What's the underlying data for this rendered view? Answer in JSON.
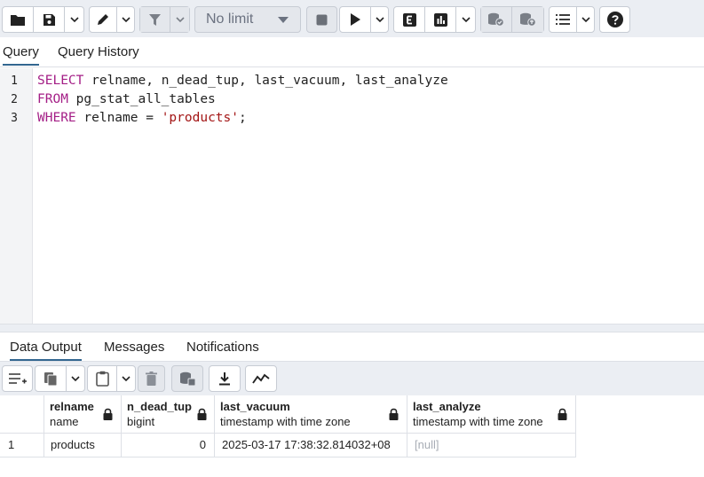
{
  "toolbar": {
    "limit_select": {
      "value": "No limit"
    },
    "icons": [
      "folder-icon",
      "save-icon",
      "pencil-icon",
      "filter-icon",
      "stop-icon",
      "play-icon",
      "explain-icon",
      "explain-analyze-icon",
      "commit-icon",
      "rollback-icon",
      "macros-icon",
      "help-icon"
    ]
  },
  "tabs": [
    {
      "label": "Query",
      "active": true
    },
    {
      "label": "Query History",
      "active": false
    }
  ],
  "editor": {
    "line_numbers": [
      "1",
      "2",
      "3"
    ],
    "lines": [
      {
        "kw": "SELECT",
        "rest": " relname, n_dead_tup, last_vacuum, last_analyze"
      },
      {
        "kw": "FROM",
        "rest": " pg_stat_all_tables"
      },
      {
        "kw": "WHERE",
        "rest": " relname = ",
        "str": "'products'",
        "end": ";"
      }
    ]
  },
  "output_tabs": [
    {
      "label": "Data Output",
      "active": true
    },
    {
      "label": "Messages",
      "active": false
    },
    {
      "label": "Notifications",
      "active": false
    }
  ],
  "grid": {
    "columns": [
      {
        "name": "relname",
        "type": "name"
      },
      {
        "name": "n_dead_tup",
        "type": "bigint"
      },
      {
        "name": "last_vacuum",
        "type": "timestamp with time zone"
      },
      {
        "name": "last_analyze",
        "type": "timestamp with time zone"
      }
    ],
    "rows": [
      {
        "row_num": "1",
        "cells": [
          "products",
          "0",
          "2025-03-17 17:38:32.814032+08",
          "[null]"
        ]
      }
    ]
  },
  "colors": {
    "keyword": "#a41e86",
    "string": "#a31515",
    "active_tab_underline": "#326690",
    "null_text": "#a8adb5"
  }
}
